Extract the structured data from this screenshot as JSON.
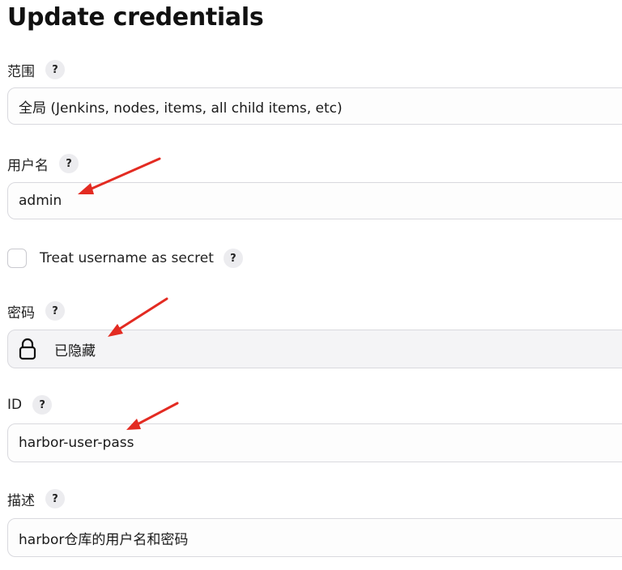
{
  "page": {
    "title": "Update credentials"
  },
  "fields": {
    "scope": {
      "label": "范围",
      "value": "全局 (Jenkins, nodes, items, all child items, etc)"
    },
    "username": {
      "label": "用户名",
      "value": "admin"
    },
    "treat_secret": {
      "label": "Treat username as secret",
      "checked": false
    },
    "password": {
      "label": "密码",
      "value": "已隐藏"
    },
    "id": {
      "label": "ID",
      "value": "harbor-user-pass"
    },
    "description": {
      "label": "描述",
      "value": "harbor仓库的用户名和密码"
    }
  },
  "help_text": "?",
  "annotation_color": "#e32b22"
}
